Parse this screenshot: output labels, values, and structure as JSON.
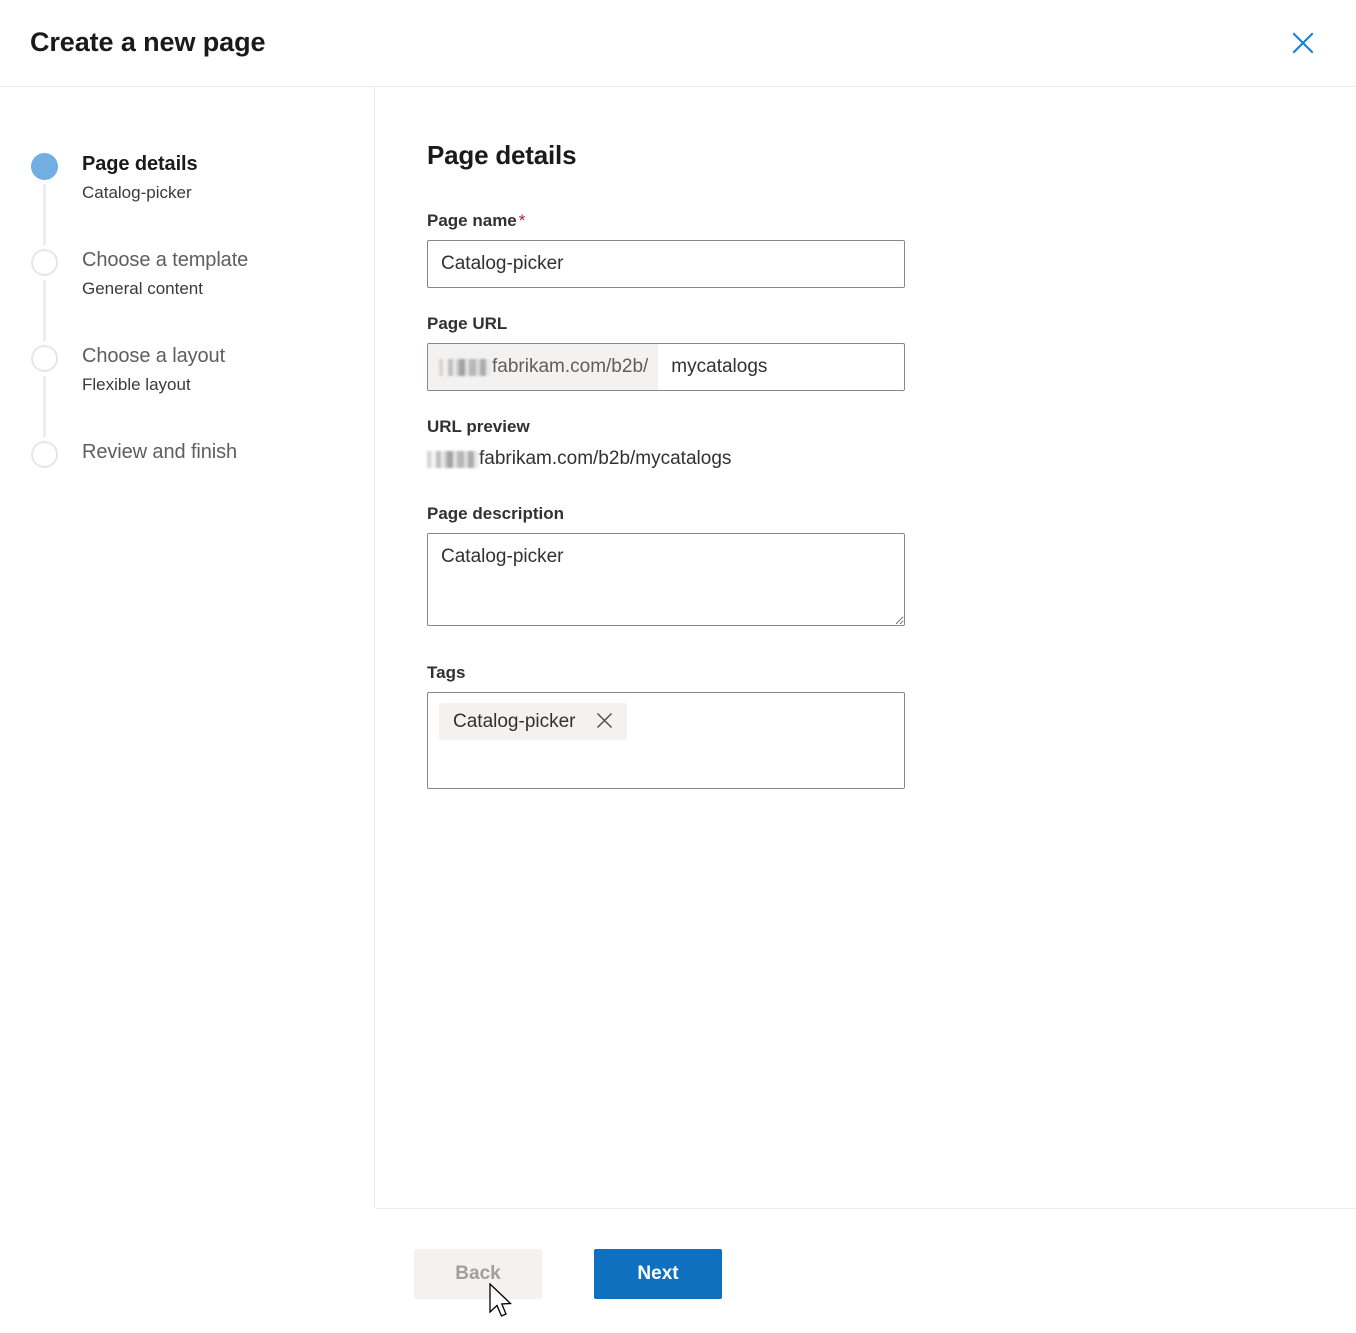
{
  "dialog": {
    "title": "Create a new page",
    "close_icon": "close-icon",
    "close_color": "#1a7fd4"
  },
  "wizard": {
    "steps": [
      {
        "title": "Page details",
        "subtitle": "Catalog-picker",
        "state": "active"
      },
      {
        "title": "Choose a template",
        "subtitle": "General content",
        "state": "inactive"
      },
      {
        "title": "Choose a layout",
        "subtitle": "Flexible layout",
        "state": "inactive"
      },
      {
        "title": "Review and finish",
        "subtitle": "",
        "state": "inactive"
      }
    ],
    "active_marker_color": "#71aee2",
    "inactive_marker_color": "#e6e6e6"
  },
  "main": {
    "heading": "Page details",
    "fields": {
      "page_name": {
        "label": "Page name",
        "required_mark": "*",
        "value": "Catalog-picker",
        "placeholder": ""
      },
      "page_url": {
        "label": "Page URL",
        "prefix_redacted": true,
        "prefix": "fabrikam.com/b2b/",
        "value": "mycatalogs",
        "placeholder": ""
      },
      "url_preview": {
        "label": "URL preview",
        "value": "fabrikam.com/b2b/mycatalogs"
      },
      "page_description": {
        "label": "Page description",
        "value": "Catalog-picker",
        "placeholder": ""
      },
      "tags": {
        "label": "Tags",
        "chips": [
          {
            "label": "Catalog-picker",
            "remove_icon": "close-icon"
          }
        ]
      }
    }
  },
  "footer": {
    "back_label": "Back",
    "back_disabled": true,
    "next_label": "Next",
    "next_color": "#0f70c0"
  }
}
